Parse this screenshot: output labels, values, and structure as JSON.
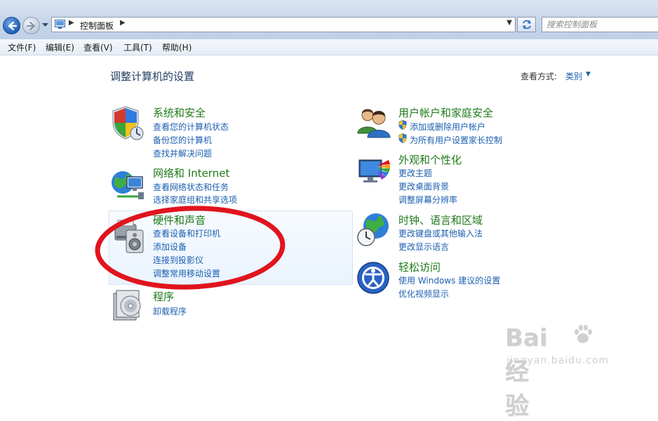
{
  "address_bar": {
    "path": "控制面板",
    "search_placeholder": "搜索控制面板"
  },
  "menu": [
    "文件(F)",
    "编辑(E)",
    "查看(V)",
    "工具(T)",
    "帮助(H)"
  ],
  "header": {
    "title": "调整计算机的设置",
    "view_by_label": "查看方式:",
    "view_by_value": "类别"
  },
  "left_categories": [
    {
      "title": "系统和安全",
      "icon": "shield-icon",
      "links": [
        "查看您的计算机状态",
        "备份您的计算机",
        "查找并解决问题"
      ]
    },
    {
      "title": "网络和 Internet",
      "icon": "network-icon",
      "links": [
        "查看网络状态和任务",
        "选择家庭组和共享选项"
      ]
    },
    {
      "title": "硬件和声音",
      "icon": "printer-speaker-icon",
      "highlighted": true,
      "links": [
        "查看设备和打印机",
        "添加设备",
        "连接到投影仪",
        "调整常用移动设置"
      ]
    },
    {
      "title": "程序",
      "icon": "programs-icon",
      "links": [
        "卸载程序"
      ]
    }
  ],
  "right_categories": [
    {
      "title": "用户帐户和家庭安全",
      "icon": "users-icon",
      "links": [
        "添加或删除用户帐户",
        "为所有用户设置家长控制"
      ]
    },
    {
      "title": "外观和个性化",
      "icon": "monitor-palette-icon",
      "links": [
        "更改主题",
        "更改桌面背景",
        "调整屏幕分辨率"
      ]
    },
    {
      "title": "时钟、语言和区域",
      "icon": "globe-clock-icon",
      "links": [
        "更改键盘或其他输入法",
        "更改显示语言"
      ]
    },
    {
      "title": "轻松访问",
      "icon": "accessibility-icon",
      "links": [
        "使用 Windows 建议的设置",
        "优化视频显示"
      ]
    }
  ],
  "watermark": {
    "main": "Bai 经验",
    "sub": "jingyan.baidu.com"
  },
  "colors": {
    "category_title": "#1f7a1a",
    "link": "#1c5fb0",
    "annotation": "#e0141e"
  }
}
